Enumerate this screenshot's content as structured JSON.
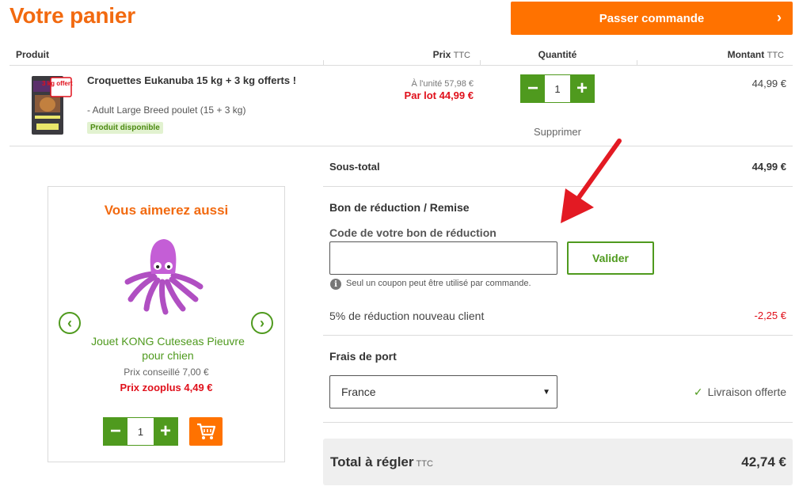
{
  "header": {
    "title": "Votre panier",
    "checkout_label": "Passer commande",
    "checkout_icon": "chevron-right-icon"
  },
  "table_header": {
    "product": "Produit",
    "price": "Prix",
    "price_suffix": "TTC",
    "quantity": "Quantité",
    "amount": "Montant",
    "amount_suffix": "TTC"
  },
  "cart_item": {
    "name": "Croquettes Eukanuba 15 kg + 3 kg offerts !",
    "variant": "- Adult Large Breed poulet (15 + 3 kg)",
    "availability": "Produit disponible",
    "unit_price": "À l'unité 57,98 €",
    "lot_price": "Par lot 44,99 €",
    "quantity": "1",
    "delete_label": "Supprimer",
    "amount": "44,99 €",
    "image_badge_text": "3 kg offerts !"
  },
  "recommendation": {
    "title": "Vous aimerez aussi",
    "name": "Jouet KONG Cuteseas Pieuvre pour chien",
    "rrp": "Prix conseillé 7,00 €",
    "price": "Prix zooplus 4,49 €",
    "quantity": "1",
    "prev_icon": "chevron-left-icon",
    "next_icon": "chevron-right-icon",
    "cart_icon": "cart-icon"
  },
  "summary": {
    "subtotal_label": "Sous-total",
    "subtotal_value": "44,99 €",
    "coupon_heading": "Bon de réduction / Remise",
    "coupon_label": "Code de votre bon de réduction",
    "coupon_value": "",
    "validate_label": "Valider",
    "coupon_note": "Seul un coupon peut être utilisé par commande.",
    "discount_label": "5% de réduction nouveau client",
    "discount_value": "-2,25 €",
    "shipping_heading": "Frais de port",
    "country": "France",
    "free_shipping": "Livraison offerte",
    "total_label": "Total à régler",
    "total_suffix": "TTC",
    "total_value": "42,74 €"
  },
  "colors": {
    "brand_orange": "#ff7200",
    "title_orange": "#f26a10",
    "green": "#4f9a1e",
    "price_red": "#e0101b",
    "arrow_red": "#e31a23"
  }
}
